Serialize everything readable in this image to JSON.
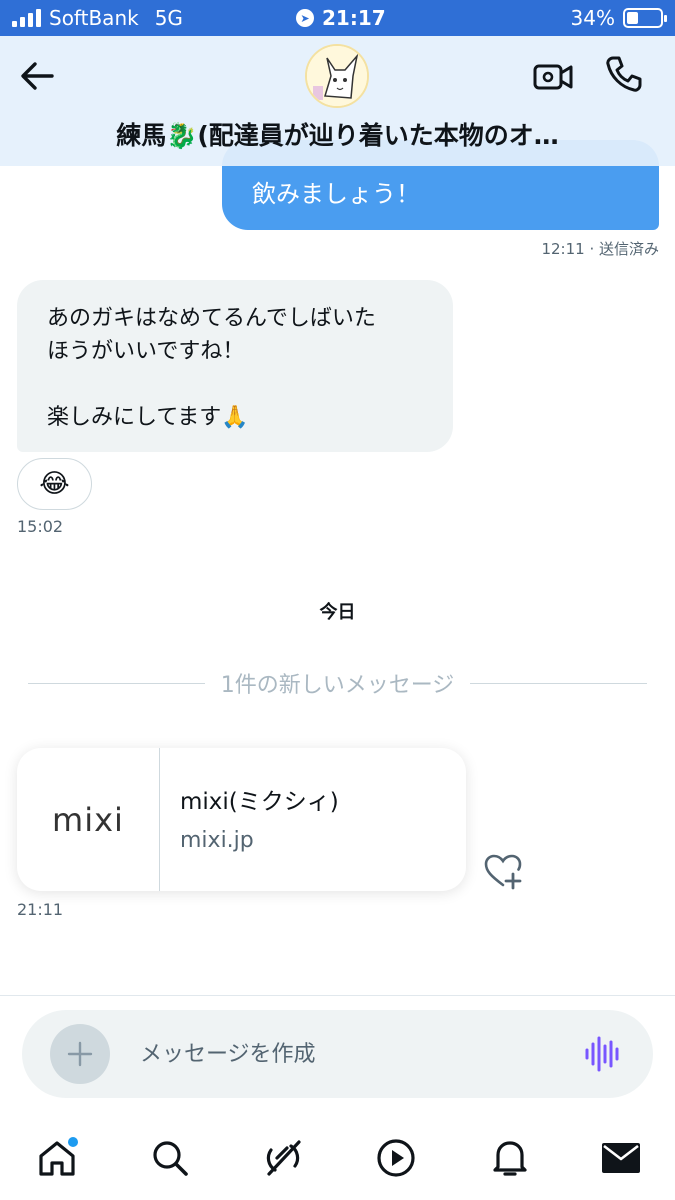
{
  "status_bar": {
    "carrier": "SoftBank",
    "network": "5G",
    "time": "21:17",
    "battery_text": "34%",
    "battery_level": 0.34
  },
  "header": {
    "conversation_title": "練馬🐉(配達員が辿り着いた本物のオ…",
    "icons": [
      "back-arrow-icon",
      "avatar",
      "video-call-icon",
      "phone-icon"
    ]
  },
  "messages": {
    "sent": {
      "text": "飲みましょう！",
      "meta": "12:11 · 送信済み"
    },
    "received": {
      "lines": [
        "あのガキはなめてるんでしばいた",
        "ほうがいいですね！",
        "",
        "楽しみにしてます🙏"
      ],
      "reaction": "😂",
      "time": "15:02"
    },
    "day_label": "今日",
    "new_divider": "1件の新しいメッセージ",
    "link_card": {
      "logo_text": "mixi",
      "title": "mixi(ミクシィ)",
      "domain": "mixi.jp",
      "time": "21:11"
    }
  },
  "composer": {
    "placeholder": "メッセージを作成",
    "value": ""
  },
  "tab_bar": {
    "items": [
      "home-icon",
      "search-icon",
      "grok-icon",
      "video-icon",
      "notifications-icon",
      "messages-icon"
    ],
    "accent": "#1d9bf0"
  },
  "colors": {
    "status_bar": "#2f6fd6",
    "sent_bubble": "#4a9df0",
    "received_bubble": "#eff3f4",
    "voice_accent": "#7856ff"
  }
}
